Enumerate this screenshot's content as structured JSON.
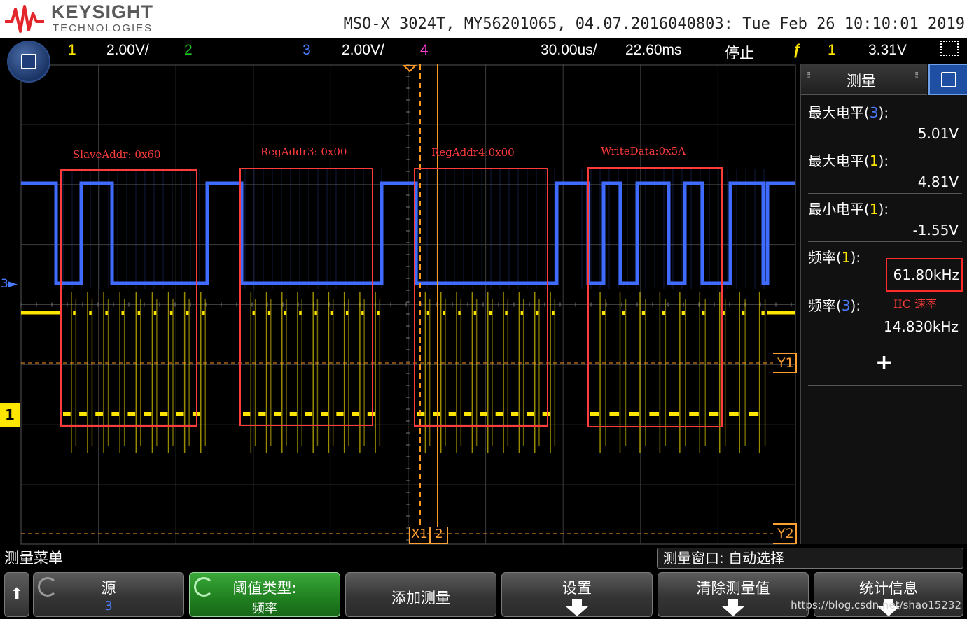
{
  "header": {
    "brand": "KEYSIGHT",
    "brand_sub": "TECHNOLOGIES",
    "scope_info": "MSO-X 3024T, MY56201065, 04.07.2016040803: Tue Feb 26 10:10:01 2019"
  },
  "status_bar": {
    "ch1_label": "1",
    "ch1_scale": "2.00V/",
    "ch2_label": "2",
    "ch3_label": "3",
    "ch3_scale": "2.00V/",
    "ch4_label": "4",
    "time_scale": "30.00us/",
    "time_delay": "22.60ms",
    "run_state": "停止",
    "trigger_source": "1",
    "trigger_level": "3.31V"
  },
  "markers": {
    "ch3_marker": "3",
    "ch1_marker": "1",
    "y1": "Y1",
    "y2": "Y2",
    "x1": "X1",
    "x2": "2"
  },
  "annotations": {
    "box1": "SlaveAddr: 0x60",
    "box2": "RegAddr3: 0x00",
    "box3": "RegAddr4:0x00",
    "box4": "WriteData:0x5A",
    "speed_note": "IIC 速率"
  },
  "measure_panel": {
    "title": "测量",
    "items": [
      {
        "label": "最大电平",
        "channel": "3",
        "value": "5.01V"
      },
      {
        "label": "最大电平",
        "channel": "1",
        "value": "4.81V"
      },
      {
        "label": "最小电平",
        "channel": "1",
        "value": "-1.55V"
      },
      {
        "label": "频率",
        "channel": "1",
        "value": "61.80kHz"
      },
      {
        "label": "频率",
        "channel": "3",
        "value": "14.830kHz"
      }
    ],
    "add_label": "+"
  },
  "bottom": {
    "menu_title": "测量菜单",
    "window_field": "测量窗口: 自动选择",
    "keys": [
      {
        "line1": "源",
        "line2": "3"
      },
      {
        "line1": "阈值类型:",
        "line2": "频率"
      },
      {
        "line1": "添加测量",
        "line2": ""
      },
      {
        "line1": "设置",
        "line2": ""
      },
      {
        "line1": "清除测量值",
        "line2": ""
      },
      {
        "line1": "统计信息",
        "line2": ""
      }
    ]
  },
  "watermark": "https://blog.csdn.net/shao15232",
  "colors": {
    "ch1": "#ffe600",
    "ch3": "#3f6bff",
    "cursor": "#ff9a1e",
    "annotation": "#ff3b3b",
    "grid": "#3c3c3c"
  }
}
